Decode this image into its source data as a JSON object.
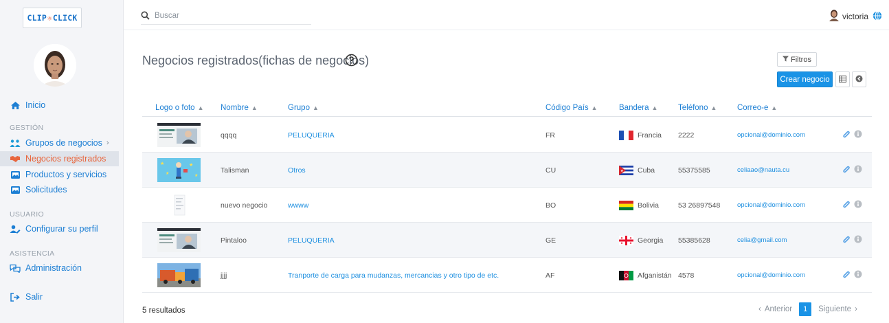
{
  "brand": {
    "logo_left": "CLIP",
    "logo_right": "CLICK"
  },
  "sidebar": {
    "home": "Inicio",
    "section_gestion": "GESTIÓN",
    "grupos": "Grupos de negocios",
    "negocios": "Negocios registrados",
    "productos": "Productos y servicios",
    "solicitudes": "Solicitudes",
    "section_usuario": "USUARIO",
    "perfil": "Configurar su perfil",
    "section_asistencia": "ASISTENCIA",
    "admin": "Administración",
    "salir": "Salir"
  },
  "topbar": {
    "search_placeholder": "Buscar",
    "username": "victoria"
  },
  "page": {
    "title": "Negocios registrados(fichas de negocios)"
  },
  "toolbar": {
    "filtros": "Filtros",
    "crear": "Crear negocio"
  },
  "table": {
    "headers": {
      "logo": "Logo o foto",
      "nombre": "Nombre",
      "grupo": "Grupo",
      "codigo": "Código País",
      "bandera": "Bandera",
      "telefono": "Teléfono",
      "correo": "Correo-e"
    },
    "rows": [
      {
        "nombre": "qqqq",
        "grupo": "PELUQUERIA",
        "codigo": "FR",
        "pais": "Francia",
        "telefono": "2222",
        "correo": "opcional@dominio.com"
      },
      {
        "nombre": "Talisman",
        "grupo": "Otros",
        "codigo": "CU",
        "pais": "Cuba",
        "telefono": "55375585",
        "correo": "celiaao@nauta.cu"
      },
      {
        "nombre": "nuevo negocio",
        "grupo": "wwww",
        "codigo": "BO",
        "pais": "Bolivia",
        "telefono": "53 26897548",
        "correo": "opcional@dominio.com"
      },
      {
        "nombre": "Pintaloo",
        "grupo": "PELUQUERIA",
        "codigo": "GE",
        "pais": "Georgia",
        "telefono": "55385628",
        "correo": "celia@gmail.com"
      },
      {
        "nombre": "jjjj",
        "grupo": "Tranporte de carga para mudanzas, mercancias y otro tipo de etc.",
        "codigo": "AF",
        "pais": "Afganistán",
        "telefono": "4578",
        "correo": "opcional@dominio.com"
      }
    ]
  },
  "footer": {
    "results": "5 resultados",
    "prev": "Anterior",
    "page": "1",
    "next": "Siguiente"
  },
  "colors": {
    "accent": "#1a93e6",
    "link": "#1d7fd4",
    "active": "#e8663d"
  }
}
